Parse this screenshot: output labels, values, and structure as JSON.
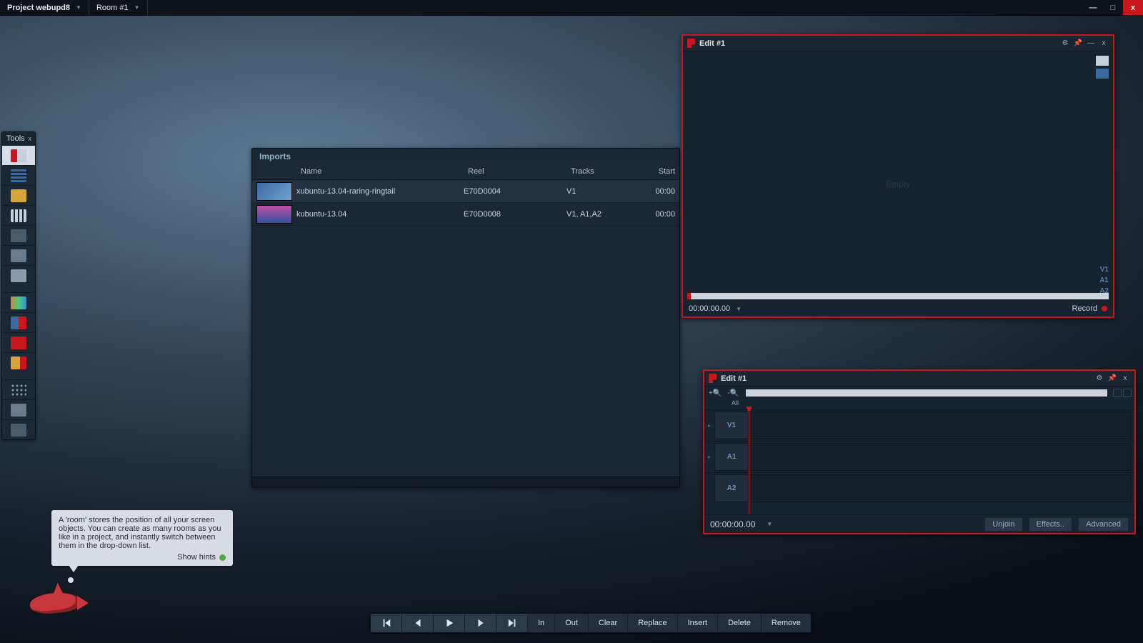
{
  "menubar": {
    "project_label": "Project webupd8",
    "room_label": "Room #1"
  },
  "tools": {
    "title": "Tools",
    "items": [
      "import-tool",
      "bins-tool",
      "folder-tool",
      "grid-tool",
      "storage-tool",
      "output-tool",
      "disk-tool",
      "scopes-tool",
      "keypad-tool",
      "cut-tool",
      "export-tool"
    ],
    "extra": [
      "apps-tool",
      "users-tool",
      "display-tool"
    ]
  },
  "imports": {
    "title": "Imports",
    "columns": {
      "name": "Name",
      "reel": "Reel",
      "tracks": "Tracks",
      "start": "Start"
    },
    "rows": [
      {
        "name": "xubuntu-13.04-raring-ringtail",
        "reel": "E70D0004",
        "tracks": "V1",
        "start": "00:00"
      },
      {
        "name": "kubuntu-13.04",
        "reel": "E70D0008",
        "tracks": "V1, A1,A2",
        "start": "00:00"
      }
    ]
  },
  "edit_viewer": {
    "title": "Edit #1",
    "placeholder": "Empty",
    "track_labels": [
      "V1",
      "A1",
      "A2"
    ],
    "timecode": "00:00:00.00",
    "record_label": "Record"
  },
  "edit_timeline": {
    "title": "Edit #1",
    "all_label": "All",
    "tracks": [
      "V1",
      "A1",
      "A2"
    ],
    "timecode": "00:00:00.00",
    "buttons": {
      "unjoin": "Unjoin",
      "effects": "Effects..",
      "advanced": "Advanced"
    }
  },
  "hint": {
    "text": "A 'room' stores the position of all your screen objects.  You can create as many rooms as you like in a project, and instantly switch between them in the drop-down list.",
    "show_hints": "Show hints"
  },
  "transport": {
    "in": "In",
    "out": "Out",
    "clear": "Clear",
    "replace": "Replace",
    "insert": "Insert",
    "delete": "Delete",
    "remove": "Remove"
  }
}
